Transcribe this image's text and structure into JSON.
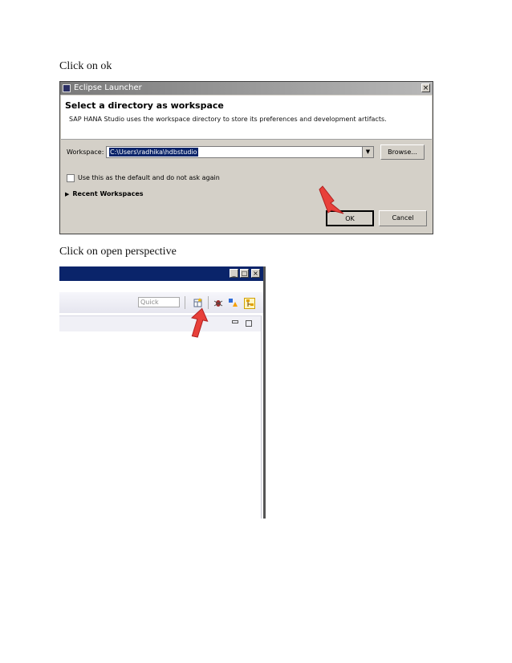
{
  "instructions": {
    "step1": "Click on ok",
    "step2": "Click on open perspective"
  },
  "dialog": {
    "title": "Eclipse Launcher",
    "close_label": "×",
    "heading": "Select a directory as workspace",
    "description": "SAP HANA Studio uses the workspace directory to store its preferences and development artifacts.",
    "workspace_label": "Workspace:",
    "workspace_value": "C:\\Users\\radhika\\hdbstudio",
    "browse_label": "Browse...",
    "checkbox_label": "Use this as the default and do not ask again",
    "checkbox_checked": false,
    "recent_label": "Recent Workspaces",
    "ok_label": "OK",
    "cancel_label": "Cancel"
  },
  "eclipse_window": {
    "minimize_label": "_",
    "maximize_label": "□",
    "close_label": "×",
    "quick_access_placeholder": "Quick Access",
    "toolbar_icons": [
      "open-perspective-icon",
      "debug-perspective-icon",
      "modeler-perspective-icon",
      "development-perspective-icon"
    ]
  },
  "colors": {
    "arrow": "#e8403a",
    "titlebar_active": "#0a246a",
    "dialog_bg": "#d4d0c8"
  }
}
